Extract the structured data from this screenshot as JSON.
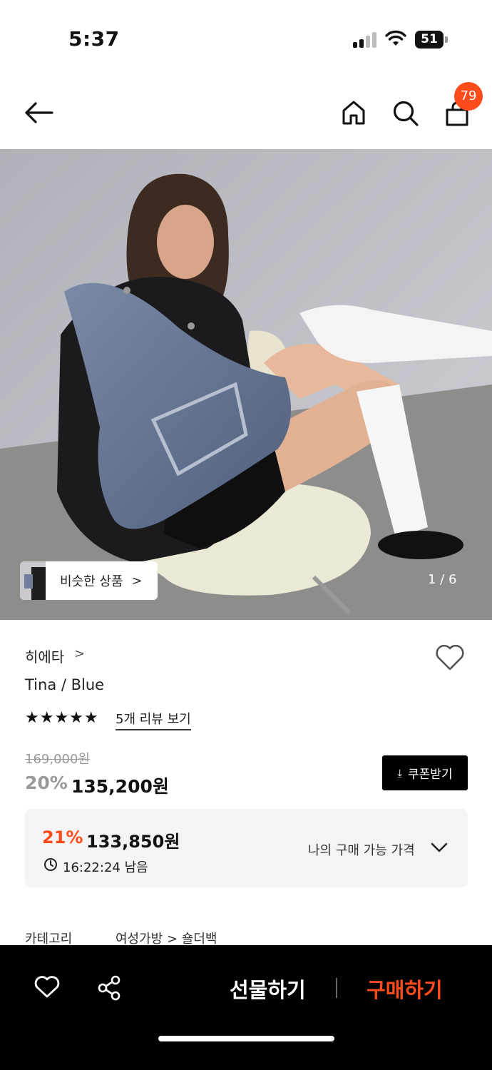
{
  "status_bar": {
    "time": "5:37",
    "battery": "51"
  },
  "header": {
    "cart_count": "79"
  },
  "gallery": {
    "similar_label": "비슷한 상품",
    "similar_chevron": ">",
    "page_indicator": "1 / 6"
  },
  "product": {
    "brand": "히에타",
    "brand_chevron": ">",
    "name": "Tina / Blue",
    "rating_stars": "★★★★★",
    "review_link": "5개 리뷰 보기",
    "original_price": "169,000원",
    "discount_rate": "20%",
    "sale_price": "135,200원",
    "coupon_label": "쿠폰받기",
    "coupon_icon": "⤓"
  },
  "my_price": {
    "rate": "21%",
    "amount": "133,850원",
    "remaining": "16:22:24 남음",
    "label": "나의 구매 가능 가격"
  },
  "category": {
    "label": "카테고리",
    "path": "여성가방 > 숄더백"
  },
  "bottom_bar": {
    "gift_label": "선물하기",
    "buy_label": "구매하기"
  },
  "colors": {
    "accent": "#ff4c1a",
    "bar": "#000000"
  },
  "icons": [
    "back-arrow-icon",
    "home-icon",
    "search-icon",
    "shopping-bag-icon",
    "heart-icon",
    "share-icon",
    "clock-icon",
    "chevron-down-icon",
    "download-icon"
  ]
}
